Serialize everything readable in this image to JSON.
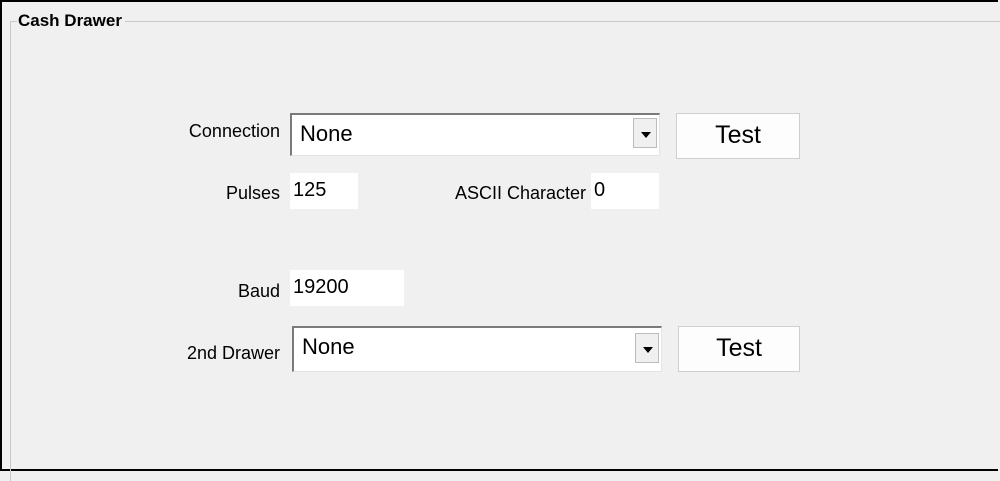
{
  "group": {
    "title": "Cash Drawer"
  },
  "connection": {
    "label": "Connection",
    "value": "None",
    "test_label": "Test"
  },
  "pulses": {
    "label": "Pulses",
    "value": "125"
  },
  "ascii_character": {
    "label": "ASCII Character",
    "value": "0"
  },
  "baud": {
    "label": "Baud",
    "value": "19200"
  },
  "second_drawer": {
    "label": "2nd Drawer",
    "value": "None",
    "test_label": "Test"
  },
  "icons": {
    "dropdown": "chevron-down-icon"
  }
}
